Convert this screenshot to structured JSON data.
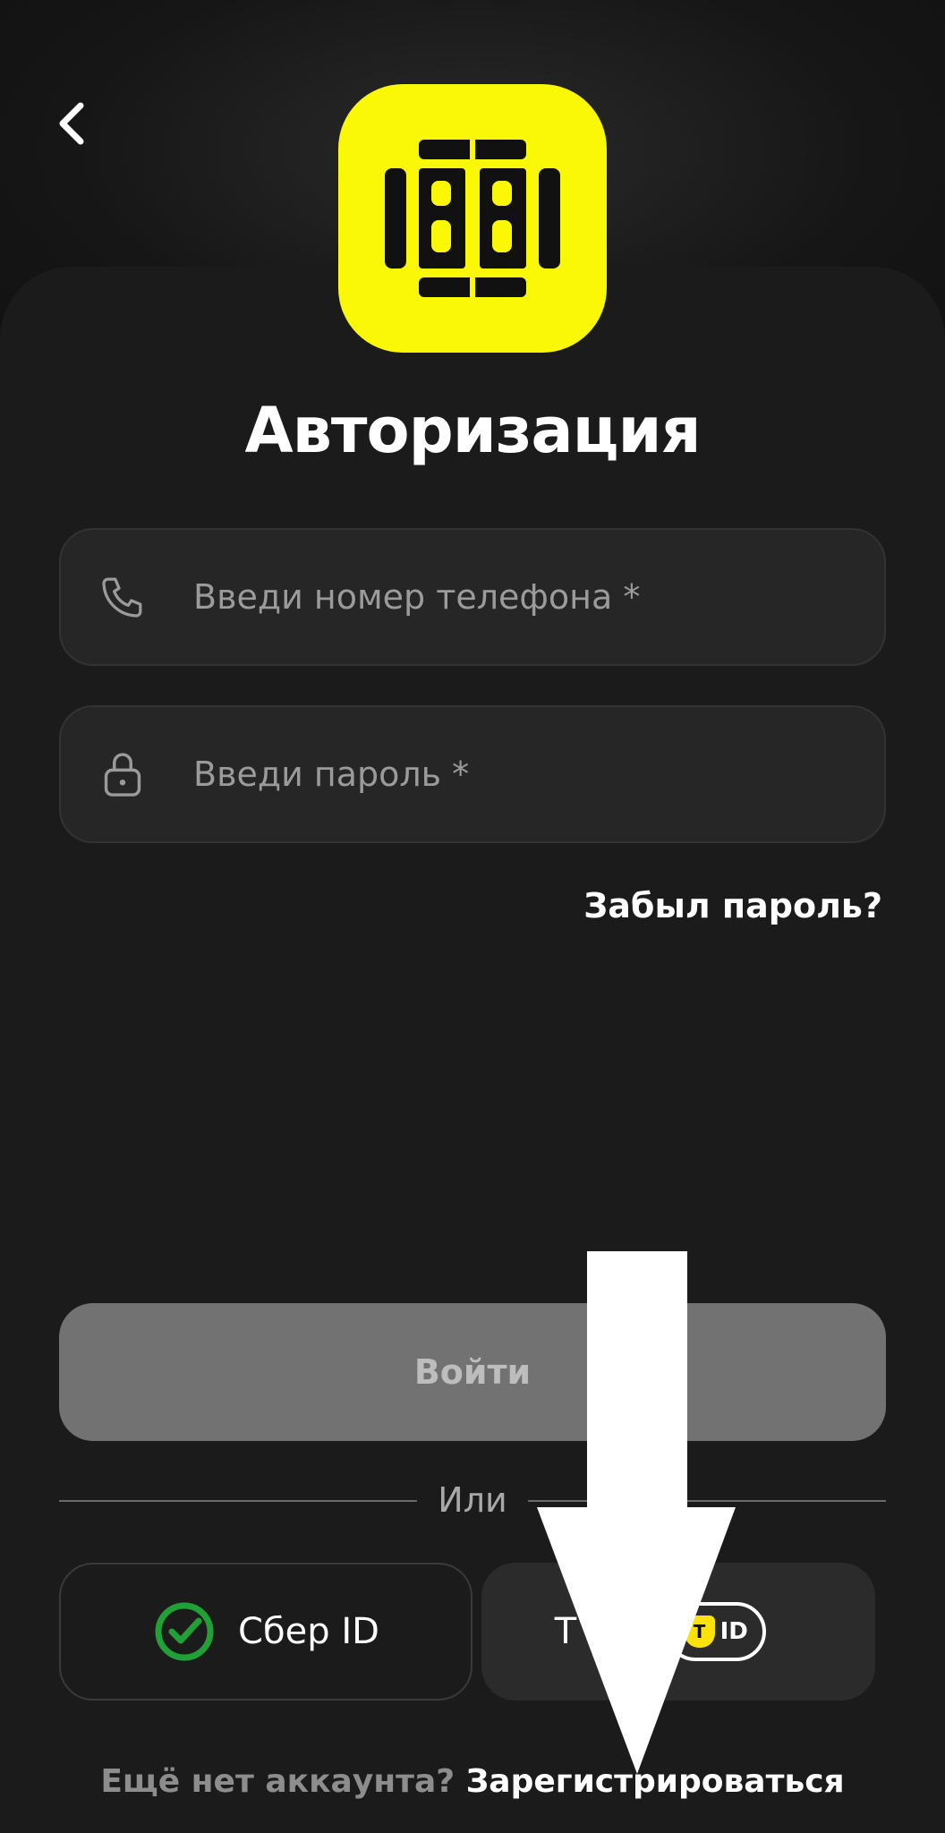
{
  "header": {
    "back_icon": "chevron-left-icon",
    "logo_icon": "bb-logo-icon",
    "title": "Авторизация"
  },
  "form": {
    "phone_placeholder": "Введи номер телефона *",
    "phone_icon": "phone-icon",
    "password_placeholder": "Введи пароль *",
    "password_icon": "lock-icon",
    "forgot_label": "Забыл пароль?",
    "login_label": "Войти",
    "or_label": "Или"
  },
  "sso": {
    "sber_label": "Сбер ID",
    "sber_icon": "sber-check-icon",
    "tid_label": "T",
    "tid_badge_letter": "T",
    "tid_badge_text": "ID"
  },
  "footer": {
    "question": "Ещё нет аккаунта?",
    "register_label": "Зарегистрироваться"
  },
  "colors": {
    "background": "#111111",
    "panel": "#1b1b1b",
    "logo_yellow": "#fbf806",
    "sber_green": "#21a038",
    "login_button": "#727272"
  }
}
